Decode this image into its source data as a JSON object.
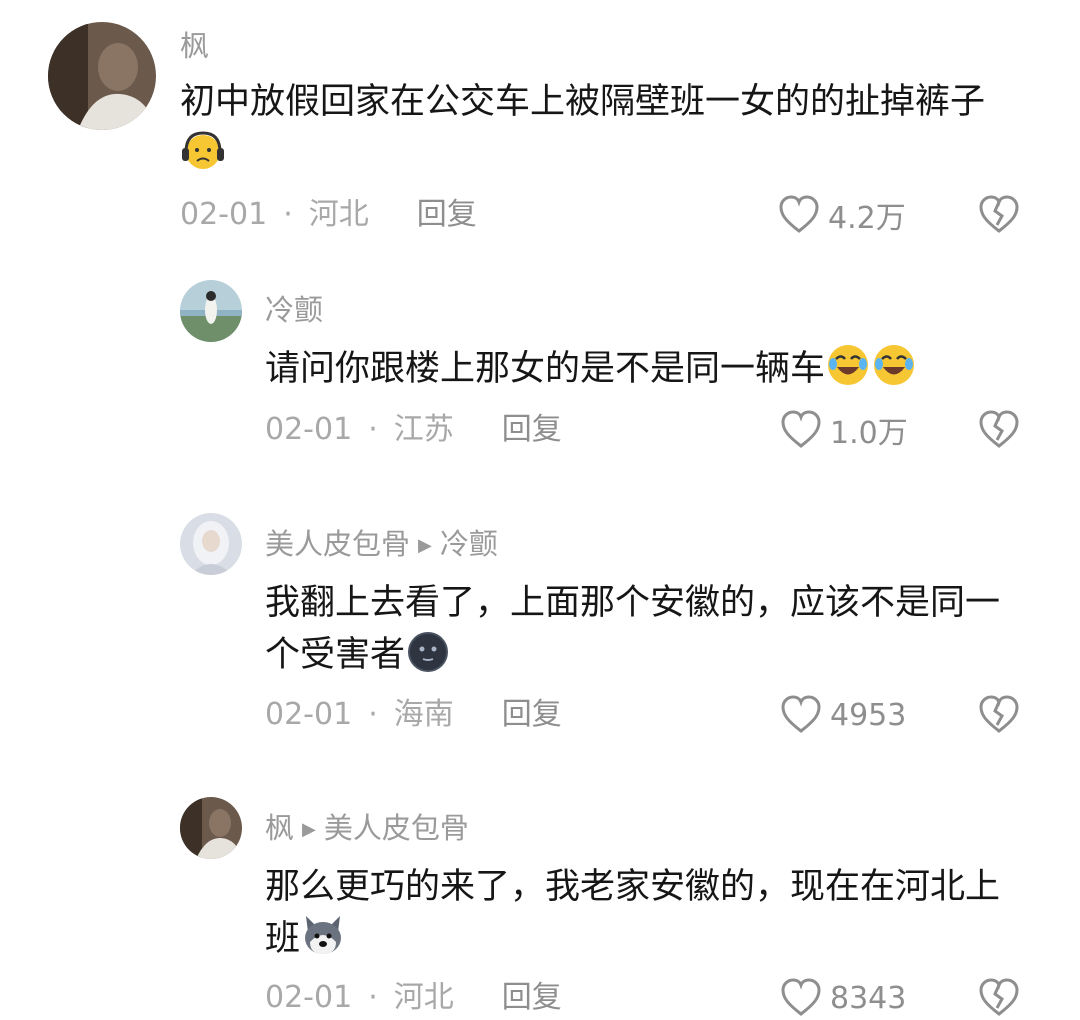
{
  "comments": [
    {
      "username": "枫",
      "text": "初中放假回家在公交车上被隔壁班一女的的扯掉裤子",
      "emoji": "headphones-sad-emoji",
      "date": "02-01",
      "dot": "·",
      "location": "河北",
      "reply_label": "回复",
      "likes": "4.2万"
    },
    {
      "username": "冷颤",
      "text": "请问你跟楼上那女的是不是同一辆车",
      "emoji": "laugh-cry-emoji",
      "date": "02-01",
      "dot": "·",
      "location": "江苏",
      "reply_label": "回复",
      "likes": "1.0万"
    },
    {
      "username": "美人皮包骨",
      "reply_to": "冷颤",
      "text_line1": "我翻上去看了，上面那个安徽的，应该不是同一",
      "text_line2": "个受害者",
      "emoji": "dark-face-emoji",
      "date": "02-01",
      "dot": "·",
      "location": "海南",
      "reply_label": "回复",
      "likes": "4953"
    },
    {
      "username": "枫",
      "reply_to": "美人皮包骨",
      "text_line1": "那么更巧的来了，我老家安徽的，现在在河北上",
      "text_line2": "班",
      "emoji": "husky-dog-emoji",
      "date": "02-01",
      "dot": "·",
      "location": "河北",
      "reply_label": "回复",
      "likes": "8343"
    }
  ],
  "colors": {
    "text": "#161616",
    "meta": "#a8a8a8",
    "icon": "#8e8e8e"
  }
}
